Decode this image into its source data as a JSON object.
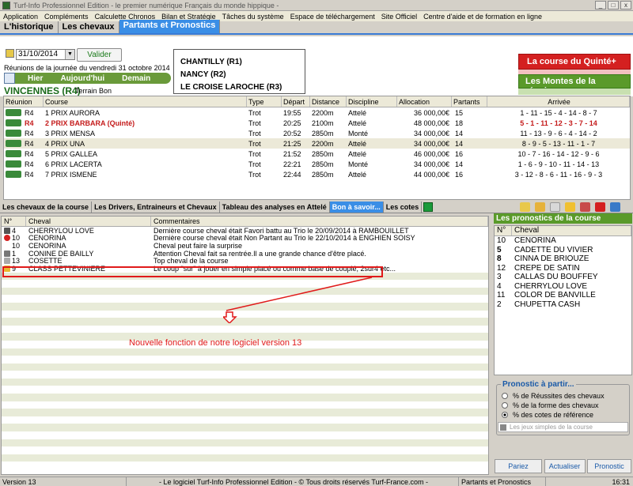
{
  "window": {
    "title": "Turf-Info Professionnel Edition - le premier numérique Français du monde hippique -"
  },
  "menu": [
    "Application",
    "Compléments",
    "Calculette Chronos",
    "Bilan et Stratégie",
    "Tâches du système",
    "Espace de téléchargement",
    "Site Officiel",
    "Centre d'aide et de formation en ligne"
  ],
  "main_tabs": [
    "L'historique",
    "Les chevaux",
    "Partants et Pronostics"
  ],
  "date": {
    "value": "31/10/2014",
    "validate_label": "Valider",
    "reunions_text": "Réunions de la journée du vendredi 31 octobre 2014",
    "nav": [
      "Hier",
      "Aujourd'hui",
      "Demain"
    ]
  },
  "venue": {
    "name": "VINCENNES (R4)",
    "terrain": "Terrain Bon"
  },
  "hippodromes": [
    "CHANTILLY (R1)",
    "NANCY (R2)",
    "LE CROISE LAROCHE (R3)"
  ],
  "side_buttons": {
    "quinte": "La course du Quinté+",
    "montes": "Les Montes de la réunion"
  },
  "races": {
    "columns": [
      "Réunion",
      "Course",
      "Type",
      "Départ",
      "Distance",
      "Discipline",
      "Allocation",
      "Partants",
      "Arrivée"
    ],
    "rows": [
      {
        "reunion": "R4",
        "course": "1 PRIX AURORA",
        "type": "Trot",
        "depart": "19:55",
        "distance": "2200m",
        "discipline": "Attelé",
        "allocation": "36 000,00€",
        "partants": "15",
        "arrivee": "1 - 11 - 15 - 4 - 14 - 8 - 7"
      },
      {
        "reunion": "R4",
        "course": "2 PRIX BARBARA (Quinté)",
        "type": "Trot",
        "depart": "20:25",
        "distance": "2100m",
        "discipline": "Attelé",
        "allocation": "48 000,00€",
        "partants": "18",
        "arrivee": "5 - 1 - 11 - 12 - 3 - 7 - 14"
      },
      {
        "reunion": "R4",
        "course": "3 PRIX MENSA",
        "type": "Trot",
        "depart": "20:52",
        "distance": "2850m",
        "discipline": "Monté",
        "allocation": "34 000,00€",
        "partants": "14",
        "arrivee": "11 - 13 - 9 - 6 - 4 - 14 - 2"
      },
      {
        "reunion": "R4",
        "course": "4 PRIX UNA",
        "type": "Trot",
        "depart": "21:25",
        "distance": "2200m",
        "discipline": "Attelé",
        "allocation": "34 000,00€",
        "partants": "14",
        "arrivee": "8 - 9 - 5 - 13 - 11 - 1 - 7"
      },
      {
        "reunion": "R4",
        "course": "5 PRIX GALLEA",
        "type": "Trot",
        "depart": "21:52",
        "distance": "2850m",
        "discipline": "Attelé",
        "allocation": "46 000,00€",
        "partants": "16",
        "arrivee": "10 - 7 - 16 - 14 - 12 - 9 - 6"
      },
      {
        "reunion": "R4",
        "course": "6 PRIX LACERTA",
        "type": "Trot",
        "depart": "22:21",
        "distance": "2850m",
        "discipline": "Monté",
        "allocation": "34 000,00€",
        "partants": "14",
        "arrivee": "1 - 6 - 9 - 10 - 11 - 14 - 13"
      },
      {
        "reunion": "R4",
        "course": "7 PRIX ISMENE",
        "type": "Trot",
        "depart": "22:44",
        "distance": "2850m",
        "discipline": "Attelé",
        "allocation": "44 000,00€",
        "partants": "16",
        "arrivee": "3 - 12 - 8 - 6 - 11 - 16 - 9 - 3"
      }
    ]
  },
  "sub_tabs": [
    "Les chevaux de la course",
    "Les Drivers, Entraineurs et Chevaux",
    "Tableau des analyses en Attelé",
    "Bon à savoir...",
    "Les cotes"
  ],
  "comments": {
    "columns": [
      "N°",
      "Cheval",
      "Commentaires"
    ],
    "rows": [
      {
        "no": "4",
        "cheval": "CHERRYLOU LOVE",
        "commentaire": "Dernière course cheval était Favori battu au Trio le 20/09/2014 à RAMBOUILLET"
      },
      {
        "no": "10",
        "cheval": "CENORINA",
        "commentaire": "Dernière course cheval était Non Partant au Trio le 22/10/2014 à ENGHIEN SOISY"
      },
      {
        "no": "10",
        "cheval": "CENORINA",
        "commentaire": "Cheval peut faire la surprise"
      },
      {
        "no": "1",
        "cheval": "CONINE DE BAILLY",
        "commentaire": "Attention Cheval fait sa rentrée.Il a une grande chance d'être placé."
      },
      {
        "no": "13",
        "cheval": "COSETTE",
        "commentaire": "Top cheval de la course"
      },
      {
        "no": "9",
        "cheval": "CLASS PETTEVINIERE",
        "commentaire": "Le coup \"sur\" à jouer en simple placé ou comme base de couplé, 2sur4 etc..."
      }
    ]
  },
  "annotation": "Nouvelle fonction de notre logiciel version 13",
  "pronostics": {
    "title": "Les pronostics de la course",
    "columns": [
      "N°",
      "Cheval"
    ],
    "rows": [
      {
        "no": "10",
        "cheval": "CENORINA"
      },
      {
        "no": "5",
        "cheval": "CADETTE DU VIVIER"
      },
      {
        "no": "8",
        "cheval": "CINNA DE BRIOUZE"
      },
      {
        "no": "12",
        "cheval": "CREPE DE SATIN"
      },
      {
        "no": "3",
        "cheval": "CALLAS DU BOUFFEY"
      },
      {
        "no": "4",
        "cheval": "CHERRYLOU LOVE"
      },
      {
        "no": "11",
        "cheval": "COLOR DE BANVILLE"
      },
      {
        "no": "2",
        "cheval": "CHUPETTA CASH"
      }
    ],
    "group_title": "Pronostic à partir...",
    "options": [
      "% de Réussites des chevaux",
      "% de la forme des chevaux",
      "% des cotes de référence"
    ],
    "jeux_placeholder": "Les jeux simples de la course",
    "buttons": [
      "Pariez",
      "Actualiser",
      "Pronostic"
    ]
  },
  "status": [
    "Version 13",
    "- Le logiciel Turf-Info Professionnel Edition - © Tous droits réservés Turf-France.com -",
    "Partants et Pronostics",
    "16:31"
  ]
}
